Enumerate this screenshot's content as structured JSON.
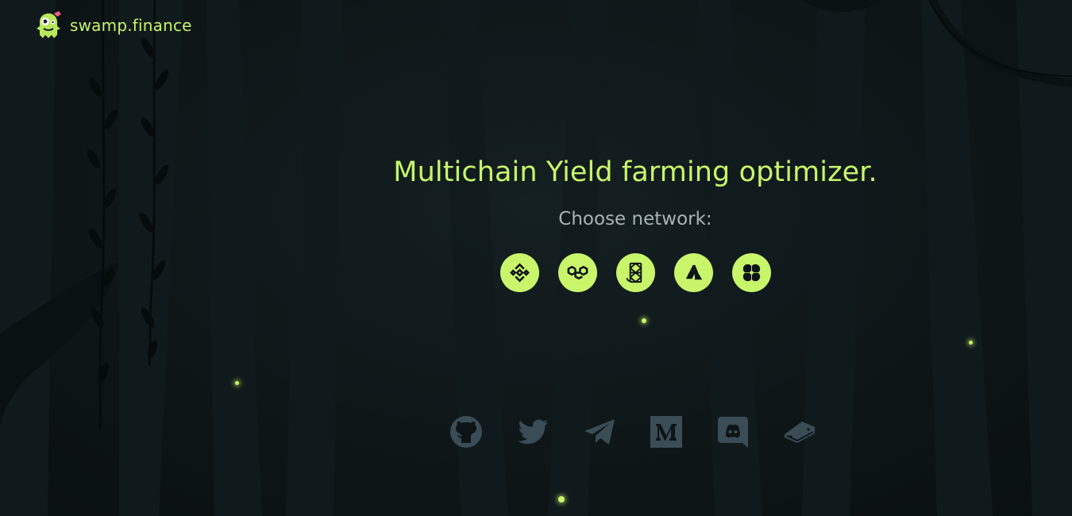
{
  "header": {
    "brand_name": "swamp.finance",
    "logo_icon": "swamp-monster-icon"
  },
  "hero": {
    "tagline": "Multichain Yield farming optimizer.",
    "choose_label": "Choose network:"
  },
  "networks": [
    {
      "icon": "binance-icon"
    },
    {
      "icon": "polygon-icon"
    },
    {
      "icon": "fantom-icon"
    },
    {
      "icon": "avalanche-icon"
    },
    {
      "icon": "okex-icon"
    }
  ],
  "socials": [
    {
      "icon": "github-icon"
    },
    {
      "icon": "twitter-icon"
    },
    {
      "icon": "telegram-icon"
    },
    {
      "icon": "medium-icon"
    },
    {
      "icon": "discord-icon"
    },
    {
      "icon": "gitbook-icon"
    }
  ],
  "colors": {
    "accent": "#c8f56a",
    "background": "#0d1416",
    "muted_text": "#a7b3b6",
    "social_icon": "#3a4c55"
  }
}
